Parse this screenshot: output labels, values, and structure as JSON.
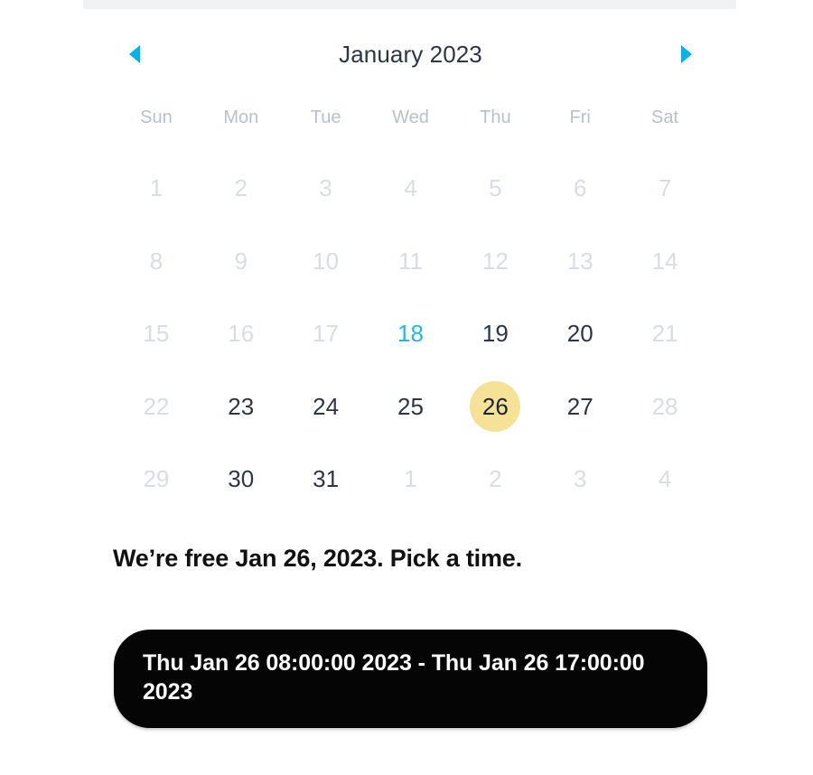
{
  "calendar": {
    "prev_icon": "chevron-left-icon",
    "next_icon": "chevron-right-icon",
    "title": "January 2023",
    "weekdays": [
      "Sun",
      "Mon",
      "Tue",
      "Wed",
      "Thu",
      "Fri",
      "Sat"
    ],
    "weeks": [
      [
        {
          "label": "1",
          "state": "disabled"
        },
        {
          "label": "2",
          "state": "disabled"
        },
        {
          "label": "3",
          "state": "disabled"
        },
        {
          "label": "4",
          "state": "disabled"
        },
        {
          "label": "5",
          "state": "disabled"
        },
        {
          "label": "6",
          "state": "disabled"
        },
        {
          "label": "7",
          "state": "disabled"
        }
      ],
      [
        {
          "label": "8",
          "state": "disabled"
        },
        {
          "label": "9",
          "state": "disabled"
        },
        {
          "label": "10",
          "state": "disabled"
        },
        {
          "label": "11",
          "state": "disabled"
        },
        {
          "label": "12",
          "state": "disabled"
        },
        {
          "label": "13",
          "state": "disabled"
        },
        {
          "label": "14",
          "state": "disabled"
        }
      ],
      [
        {
          "label": "15",
          "state": "disabled"
        },
        {
          "label": "16",
          "state": "disabled"
        },
        {
          "label": "17",
          "state": "disabled"
        },
        {
          "label": "18",
          "state": "today"
        },
        {
          "label": "19",
          "state": "enabled"
        },
        {
          "label": "20",
          "state": "enabled"
        },
        {
          "label": "21",
          "state": "disabled"
        }
      ],
      [
        {
          "label": "22",
          "state": "disabled"
        },
        {
          "label": "23",
          "state": "enabled"
        },
        {
          "label": "24",
          "state": "enabled"
        },
        {
          "label": "25",
          "state": "enabled"
        },
        {
          "label": "26",
          "state": "selected"
        },
        {
          "label": "27",
          "state": "enabled"
        },
        {
          "label": "28",
          "state": "disabled"
        }
      ],
      [
        {
          "label": "29",
          "state": "disabled"
        },
        {
          "label": "30",
          "state": "enabled"
        },
        {
          "label": "31",
          "state": "enabled"
        },
        {
          "label": "1",
          "state": "disabled"
        },
        {
          "label": "2",
          "state": "disabled"
        },
        {
          "label": "3",
          "state": "disabled"
        },
        {
          "label": "4",
          "state": "disabled"
        }
      ]
    ]
  },
  "headline": "We’re free Jan 26, 2023. Pick a time.",
  "slot_button": {
    "label": "Thu Jan 26 08:00:00 2023 - Thu Jan 26 17:00:00 2023"
  },
  "colors": {
    "accent_cyan": "#22b6ea",
    "selected_yellow": "#f6e296",
    "date_text": "#2b3647",
    "date_disabled": "#d7dee6",
    "weekday_text": "#b8c2ce",
    "button_bg": "#050505",
    "top_strip": "#f1f2f3"
  }
}
